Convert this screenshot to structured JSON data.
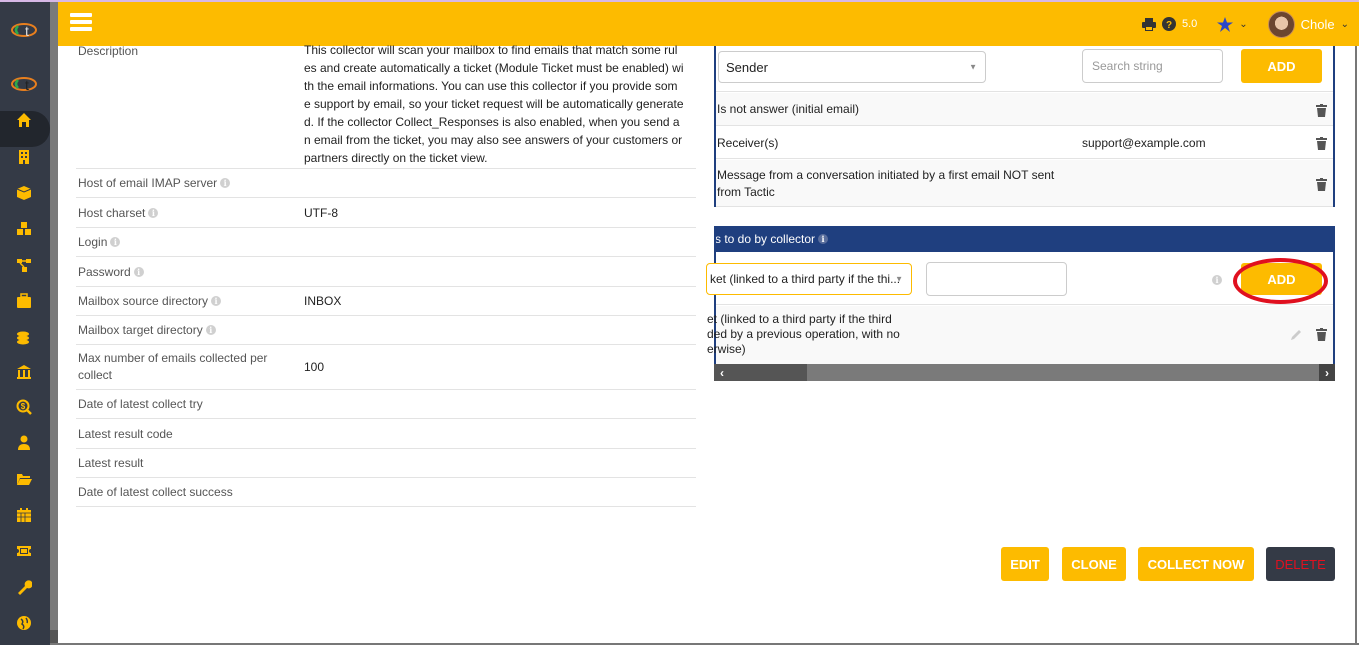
{
  "header": {
    "version": "5.0",
    "user_name": "Chole",
    "icons": [
      "print-icon",
      "help-icon",
      "star-icon",
      "chevron-down-icon",
      "avatar"
    ]
  },
  "sidebar": {
    "logo": "tactic-logo",
    "items": [
      {
        "icon": "home-icon",
        "active": true
      },
      {
        "icon": "building-icon"
      },
      {
        "icon": "box-icon"
      },
      {
        "icon": "cubes-icon"
      },
      {
        "icon": "sitemap-icon"
      },
      {
        "icon": "briefcase-icon"
      },
      {
        "icon": "coins-icon"
      },
      {
        "icon": "bank-icon"
      },
      {
        "icon": "search-dollar-icon"
      },
      {
        "icon": "user-tie-icon"
      },
      {
        "icon": "folder-open-icon"
      },
      {
        "icon": "calendar-icon"
      },
      {
        "icon": "ticket-icon"
      },
      {
        "icon": "wrench-icon"
      },
      {
        "icon": "globe-icon"
      }
    ]
  },
  "properties": {
    "description_label": "Description",
    "description_value": "This collector will scan your mailbox to find emails that match some rules and create automatically a ticket (Module Ticket must be enabled) with the email informations. You can use this collector if you provide some support by email, so your ticket request will be automatically generated. If the collector Collect_Responses is also enabled, when you send an email from the ticket, you may also see answers of your customers or partners directly on the ticket view.",
    "description_lines": [
      "This collector will scan your mailbox to find emails that match some rul",
      "es and create automatically a ticket (Module Ticket must be enabled) wi",
      "th the email informations. You can use this collector if you provide som",
      "e support by email, so your ticket request will be automatically generate",
      "d. If the collector Collect_Responses is also enabled, when you send a",
      "n email from the ticket, you may also see answers of your customers or",
      "partners directly on the ticket view."
    ],
    "rows": [
      {
        "label": "Host of email IMAP server",
        "value": "",
        "info": true
      },
      {
        "label": "Host charset",
        "value": "UTF-8",
        "info": true
      },
      {
        "label": "Login",
        "value": "",
        "info": true
      },
      {
        "label": "Password",
        "value": "",
        "info": true
      },
      {
        "label": "Mailbox source directory",
        "value": "INBOX",
        "info": true
      },
      {
        "label": "Mailbox target directory",
        "value": "",
        "info": true
      },
      {
        "label": "Max number of emails collected per collect",
        "value": "100",
        "info": false
      },
      {
        "label": "Date of latest collect try",
        "value": "",
        "info": false
      },
      {
        "label": "Latest result code",
        "value": "",
        "info": false
      },
      {
        "label": "Latest result",
        "value": "",
        "info": false
      },
      {
        "label": "Date of latest collect success",
        "value": "",
        "info": false
      }
    ]
  },
  "filters": {
    "field_select": "Sender",
    "search_placeholder": "Search string",
    "add_label": "ADD",
    "rules": [
      {
        "text": "Is not answer (initial email)",
        "value": ""
      },
      {
        "text": "Receiver(s)",
        "value": "support@example.com"
      },
      {
        "text": "Message from a conversation initiated by a first email NOT sent",
        "text2": "from Tactic",
        "value": ""
      }
    ]
  },
  "operations": {
    "header": "s to do by collector",
    "operation_select": "ket (linked to a third party if the thi...",
    "param_value": "",
    "add_label": "ADD",
    "rows": [
      {
        "lines": [
          "et (linked to a third party if the third",
          "ded by a previous operation, with no",
          "erwise)"
        ]
      }
    ]
  },
  "actions": {
    "edit": "EDIT",
    "clone": "CLONE",
    "collect_now": "COLLECT NOW",
    "delete": "DELETE"
  },
  "colors": {
    "accent": "#fdbb00",
    "sidebar": "#343a46",
    "section_header": "#1f3f7f",
    "delete_text": "#e0101f",
    "highlight_ellipse": "#e0101f"
  }
}
